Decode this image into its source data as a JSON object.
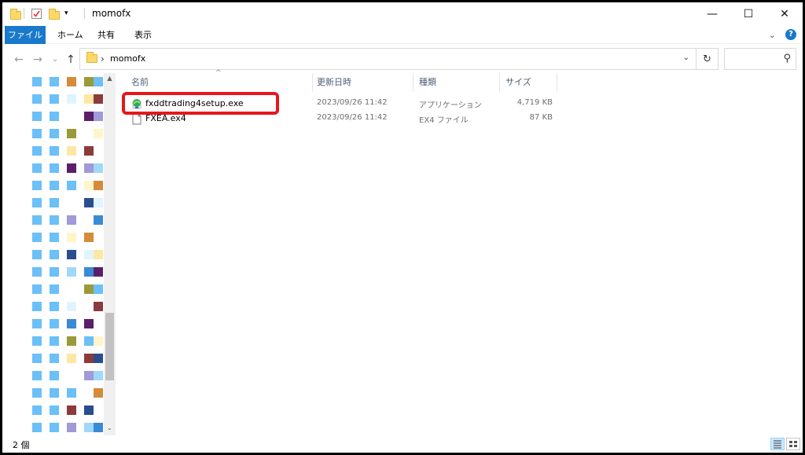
{
  "window": {
    "title": "momofx",
    "controls": {
      "minimize": "—",
      "maximize": "☐",
      "close": "✕"
    }
  },
  "ribbon": {
    "tabs": [
      {
        "label": "ファイル",
        "active": true
      },
      {
        "label": "ホーム"
      },
      {
        "label": "共有"
      },
      {
        "label": "表示"
      }
    ],
    "help": "?"
  },
  "address_bar": {
    "path": [
      "momofx"
    ],
    "search_placeholder": ""
  },
  "icons": {
    "back": "←",
    "forward": "→",
    "recent": "⌄",
    "up": "↑",
    "dropdown": "⌄",
    "refresh": "↻",
    "search": "⚲",
    "sort_up": "^",
    "expand_ribbon": "⌄",
    "nav_scroll_up": "▲",
    "nav_scroll_down": "⌄"
  },
  "file_list": {
    "columns": [
      "名前",
      "更新日時",
      "種類",
      "サイズ"
    ],
    "files": [
      {
        "name": "fxddtrading4setup.exe",
        "modified": "2023/09/26 11:42",
        "type": "アプリケーション",
        "size": "4,719 KB",
        "icon": "exe-setup-icon",
        "highlighted": true
      },
      {
        "name": "FXEA.ex4",
        "modified": "2023/09/26 11:42",
        "type": "EX4 ファイル",
        "size": "87 KB",
        "icon": "generic-file-icon",
        "highlighted": false
      }
    ]
  },
  "status_bar": {
    "item_count": "2 個"
  },
  "colors": {
    "accent": "#1979ca",
    "highlight_border": "#e6161d",
    "header_text": "#4c607a"
  }
}
